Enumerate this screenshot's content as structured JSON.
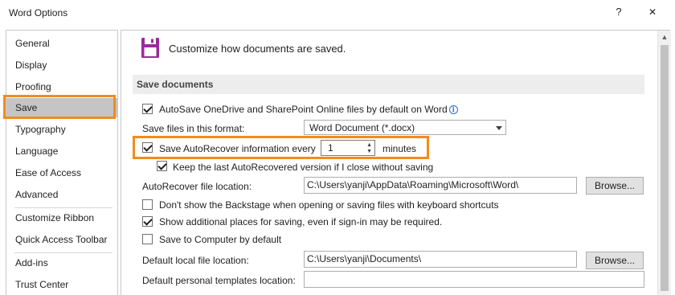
{
  "window": {
    "title": "Word Options",
    "help_label": "?",
    "close_label": "✕"
  },
  "sidebar": {
    "items": [
      {
        "label": "General"
      },
      {
        "label": "Display"
      },
      {
        "label": "Proofing"
      },
      {
        "label": "Save",
        "selected": true
      },
      {
        "label": "Typography"
      },
      {
        "label": "Language"
      },
      {
        "label": "Ease of Access"
      },
      {
        "label": "Advanced"
      },
      {
        "label": "Customize Ribbon"
      },
      {
        "label": "Quick Access Toolbar"
      },
      {
        "label": "Add-ins"
      },
      {
        "label": "Trust Center"
      }
    ]
  },
  "main": {
    "header_text": "Customize how documents are saved.",
    "header_icon": "save-disk-icon",
    "section_title": "Save documents",
    "autosave_label": "AutoSave OneDrive and SharePoint Online files by default on Word",
    "autosave_checked": true,
    "save_format_label": "Save files in this format:",
    "save_format_value": "Word Document (*.docx)",
    "autorecover_label": "Save AutoRecover information every",
    "autorecover_checked": true,
    "autorecover_minutes": "1",
    "minutes_label": "minutes",
    "keep_last_label": "Keep the last AutoRecovered version if I close without saving",
    "keep_last_checked": true,
    "autorecover_location_label": "AutoRecover file location:",
    "autorecover_location_value": "C:\\Users\\yanji\\AppData\\Roaming\\Microsoft\\Word\\",
    "browse_label": "Browse...",
    "backstage_label": "Don't show the Backstage when opening or saving files with keyboard shortcuts",
    "backstage_checked": false,
    "additional_places_label": "Show additional places for saving, even if sign-in may be required.",
    "additional_places_checked": true,
    "save_to_computer_label": "Save to Computer by default",
    "save_to_computer_checked": false,
    "default_local_label": "Default local file location:",
    "default_local_value": "C:\\Users\\yanji\\Documents\\",
    "default_templates_label": "Default personal templates location:",
    "default_templates_value": ""
  },
  "colors": {
    "highlight": "#f28b1b",
    "selected_nav": "#c5c5c5",
    "section_bar": "#ededed",
    "icon_purple": "#9b2a9b"
  }
}
